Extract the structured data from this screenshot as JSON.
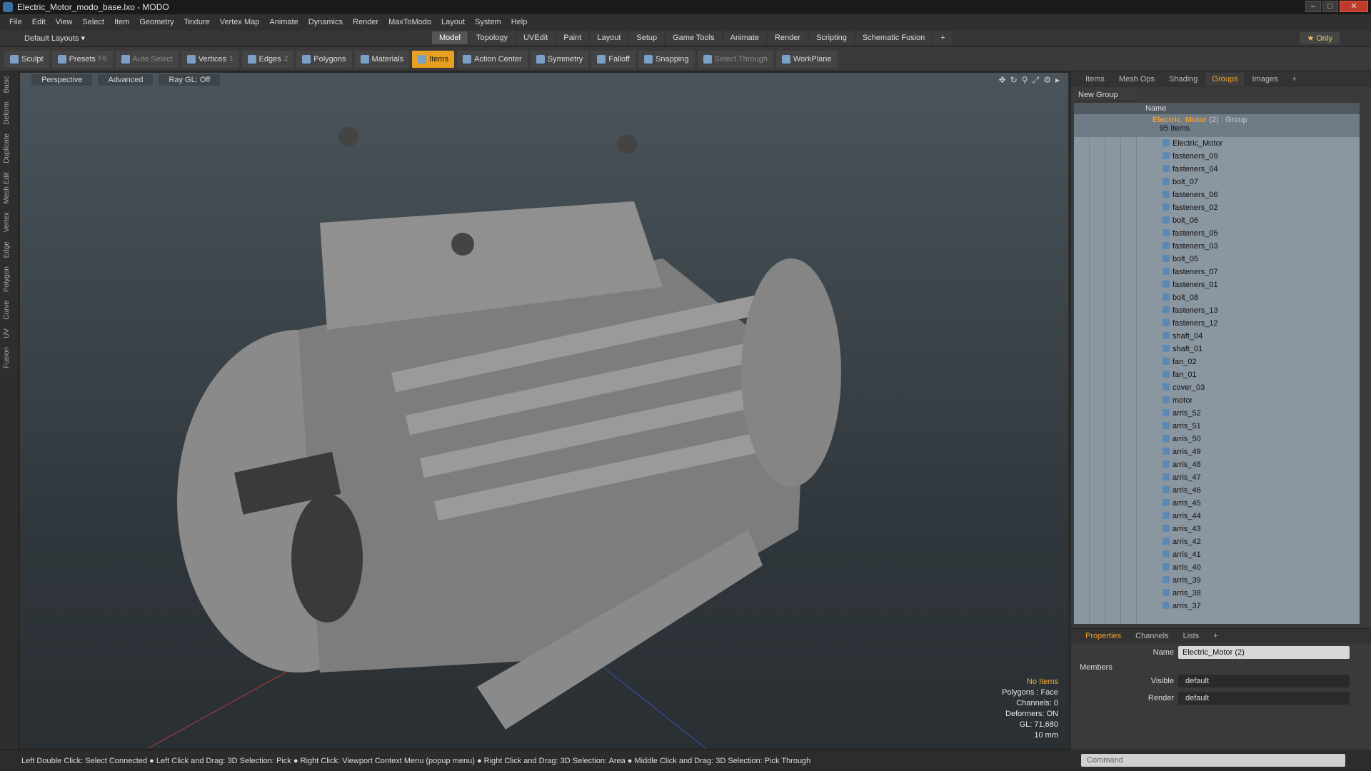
{
  "window": {
    "title": "Electric_Motor_modo_base.lxo - MODO",
    "min": "–",
    "max": "□",
    "close": "✕"
  },
  "menu": [
    "File",
    "Edit",
    "View",
    "Select",
    "Item",
    "Geometry",
    "Texture",
    "Vertex Map",
    "Animate",
    "Dynamics",
    "Render",
    "MaxToModo",
    "Layout",
    "System",
    "Help"
  ],
  "layouts": {
    "label": "Default Layouts ▾",
    "tabs": [
      "Model",
      "Topology",
      "UVEdit",
      "Paint",
      "Layout",
      "Setup",
      "Game Tools",
      "Animate",
      "Render",
      "Scripting",
      "Schematic Fusion"
    ],
    "add": "+",
    "only": "★ Only"
  },
  "toolbar": {
    "sculpt": "Sculpt",
    "presets": "Presets",
    "presets_key": "F6",
    "auto_select": "Auto Select",
    "vertices": "Vertices",
    "vertices_key": "1",
    "edges": "Edges",
    "edges_key": "2",
    "polygons": "Polygons",
    "materials": "Materials",
    "items": "Items",
    "action_center": "Action Center",
    "symmetry": "Symmetry",
    "falloff": "Falloff",
    "snapping": "Snapping",
    "select_through": "Select Through",
    "workplane": "WorkPlane"
  },
  "left_tabs": [
    "Basic",
    "Deform",
    "Duplicate",
    "Mesh Edit",
    "Vertex",
    "Edge",
    "Polygon",
    "Curve",
    "UV",
    "Fusion"
  ],
  "viewport": {
    "view": "Perspective",
    "shading": "Advanced",
    "raygl": "Ray GL: Off",
    "info": {
      "items": "No Items",
      "polygons": "Polygons : Face",
      "channels": "Channels: 0",
      "deformers": "Deformers: ON",
      "gl": "GL: 71,680",
      "scale": "10 mm"
    }
  },
  "status": "Left Double Click: Select Connected ● Left Click and Drag: 3D Selection: Pick ● Right Click: Viewport Context Menu (popup menu) ● Right Click and Drag: 3D Selection: Area ● Middle Click and Drag: 3D Selection: Pick Through",
  "right_panel": {
    "tabs": [
      "Items",
      "Mesh Ops",
      "Shading",
      "Groups",
      "Images",
      "+"
    ],
    "active": "Groups",
    "new_group": "New Group",
    "col_name": "Name",
    "group": {
      "name": "Electric_Motor",
      "suffix": "(2) : Group",
      "count": "95 Items"
    },
    "items": [
      "Electric_Motor",
      "fasteners_09",
      "fasteners_04",
      "bolt_07",
      "fasteners_06",
      "fasteners_02",
      "bolt_06",
      "fasteners_05",
      "fasteners_03",
      "bolt_05",
      "fasteners_07",
      "fasteners_01",
      "bolt_08",
      "fasteners_13",
      "fasteners_12",
      "shaft_04",
      "shaft_01",
      "fan_02",
      "fan_01",
      "cover_03",
      "motor",
      "arris_52",
      "arris_51",
      "arris_50",
      "arris_49",
      "arris_48",
      "arris_47",
      "arris_46",
      "arris_45",
      "arris_44",
      "arris_43",
      "arris_42",
      "arris_41",
      "arris_40",
      "arris_39",
      "arris_38",
      "arris_37"
    ]
  },
  "properties": {
    "tabs": [
      "Properties",
      "Channels",
      "Lists",
      "+"
    ],
    "name_label": "Name",
    "name_value": "Electric_Motor (2)",
    "members": "Members",
    "visible_label": "Visible",
    "visible_value": "default",
    "render_label": "Render",
    "render_value": "default"
  },
  "command": {
    "placeholder": "Command"
  }
}
